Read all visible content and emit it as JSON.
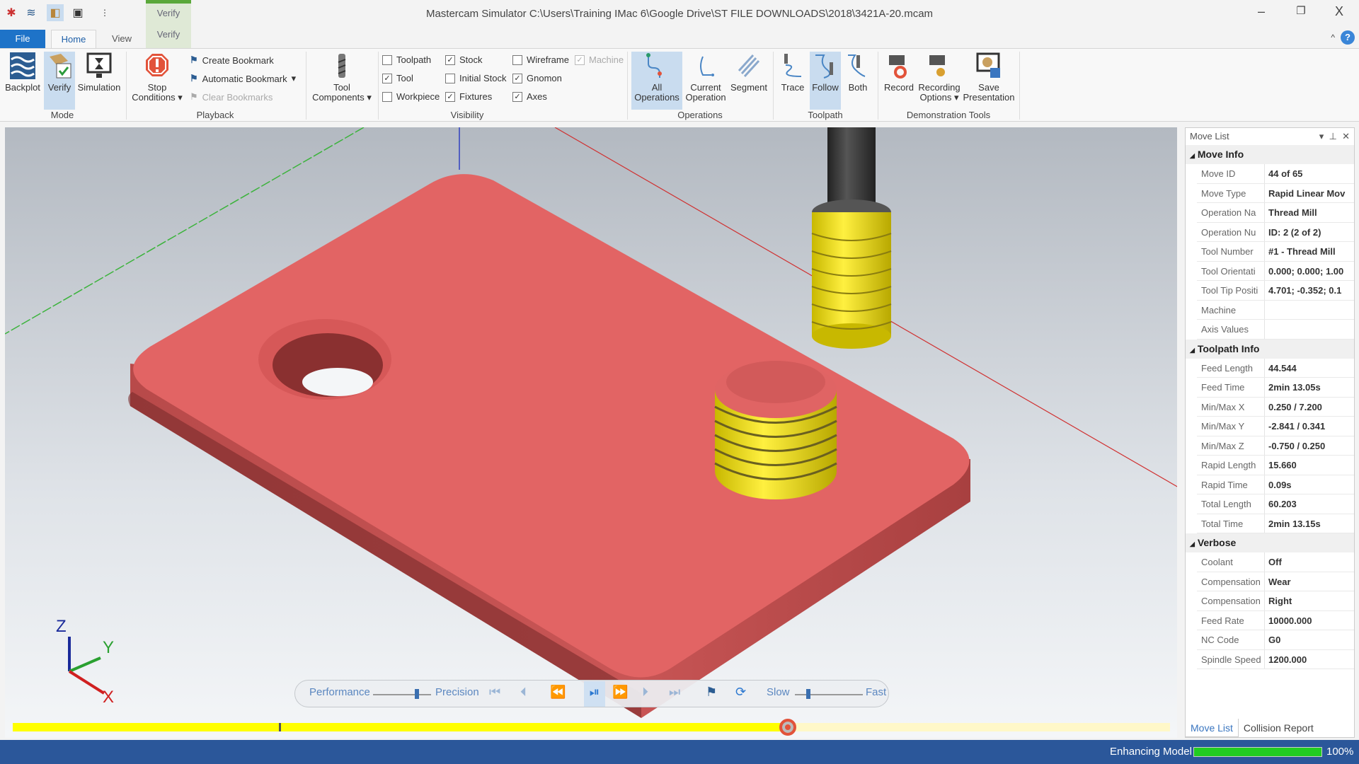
{
  "window": {
    "title": "Mastercam Simulator  C:\\Users\\Training IMac 6\\Google Drive\\ST FILE DOWNLOADS\\2018\\3421A-20.mcam",
    "minimize": "–",
    "restore": "❐",
    "close": "X"
  },
  "context_tab": {
    "group": "Verify",
    "tab": "Verify"
  },
  "tabs": [
    {
      "label": "File"
    },
    {
      "label": "Home"
    },
    {
      "label": "View"
    }
  ],
  "ribbon": {
    "mode": {
      "label": "Mode",
      "items": [
        "Backplot",
        "Verify",
        "Simulation"
      ],
      "selected": "Verify"
    },
    "playback": {
      "label": "Playback",
      "stop_conditions": "Stop Conditions",
      "create_bookmark": "Create Bookmark",
      "automatic_bookmark": "Automatic Bookmark",
      "clear_bookmarks": "Clear Bookmarks"
    },
    "tool_components": "Tool Components",
    "visibility": {
      "label": "Visibility",
      "checkboxes": [
        {
          "label": "Toolpath",
          "checked": false
        },
        {
          "label": "Tool",
          "checked": true
        },
        {
          "label": "Workpiece",
          "checked": false
        },
        {
          "label": "Stock",
          "checked": true
        },
        {
          "label": "Initial Stock",
          "checked": false
        },
        {
          "label": "Fixtures",
          "checked": true
        },
        {
          "label": "Wireframe",
          "checked": false
        },
        {
          "label": "Gnomon",
          "checked": true
        },
        {
          "label": "Axes",
          "checked": true
        },
        {
          "label": "Machine",
          "checked": true,
          "disabled": true
        }
      ]
    },
    "operations": {
      "label": "Operations",
      "all_line1": "All",
      "all_line2": "Operations",
      "current_line1": "Current",
      "current_line2": "Operation",
      "segment": "Segment"
    },
    "toolpath": {
      "label": "Toolpath",
      "items": [
        "Trace",
        "Follow",
        "Both"
      ],
      "selected": "Follow"
    },
    "demo": {
      "label": "Demonstration Tools",
      "record": "Record",
      "rec_opt1": "Recording",
      "rec_opt2": "Options",
      "save1": "Save",
      "save2": "Presentation"
    }
  },
  "gnomon": {
    "z": "Z",
    "y": "Y",
    "x": "X"
  },
  "playback_bar": {
    "performance": "Performance",
    "precision": "Precision",
    "slow": "Slow",
    "fast": "Fast",
    "quality_slider": 0.75,
    "speed_slider": 0.2
  },
  "progress": {
    "fraction": 0.67,
    "bookmark_fraction": 0.23
  },
  "move_list": {
    "title": "Move List",
    "sections": [
      {
        "title": "Move Info",
        "rows": [
          [
            "Move ID",
            "44 of 65"
          ],
          [
            "Move Type",
            "Rapid Linear Mov"
          ],
          [
            "Operation Na",
            "Thread Mill"
          ],
          [
            "Operation Nu",
            "ID: 2 (2 of 2)"
          ],
          [
            "Tool Number",
            "#1 -  Thread Mill"
          ],
          [
            "Tool Orientati",
            "0.000; 0.000; 1.00"
          ],
          [
            "Tool Tip Positi",
            "4.701; -0.352; 0.1"
          ],
          [
            "Machine",
            ""
          ],
          [
            "Axis Values",
            ""
          ]
        ]
      },
      {
        "title": "Toolpath Info",
        "rows": [
          [
            "Feed Length",
            "44.544"
          ],
          [
            "Feed Time",
            "2min 13.05s"
          ],
          [
            "Min/Max X",
            "0.250 / 7.200"
          ],
          [
            "Min/Max Y",
            "-2.841 / 0.341"
          ],
          [
            "Min/Max Z",
            "-0.750 / 0.250"
          ],
          [
            "Rapid Length",
            "15.660"
          ],
          [
            "Rapid Time",
            "0.09s"
          ],
          [
            "Total Length",
            "60.203"
          ],
          [
            "Total Time",
            "2min 13.15s"
          ]
        ]
      },
      {
        "title": "Verbose",
        "rows": [
          [
            "Coolant",
            "Off"
          ],
          [
            "Compensation",
            "Wear"
          ],
          [
            "Compensation",
            "Right"
          ],
          [
            "Feed Rate",
            "10000.000"
          ],
          [
            "NC Code",
            "G0"
          ],
          [
            "Spindle Speed",
            "1200.000"
          ]
        ]
      }
    ]
  },
  "panel_tabs": [
    "Move List",
    "Collision Report"
  ],
  "status": {
    "text": "Enhancing Model",
    "percent": "100%",
    "progress": 1.0
  },
  "colors": {
    "accent": "#2b579a",
    "stock": "#e06060",
    "thread": "#f0e020",
    "progress_green": "#22cc22"
  }
}
